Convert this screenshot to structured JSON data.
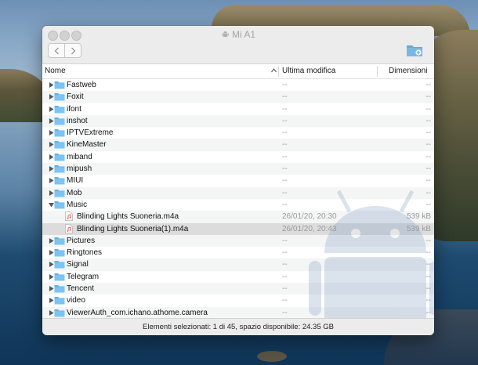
{
  "window": {
    "title": "Mi A1",
    "status": "Elementi selezionati: 1 di 45, spazio disponibile: 24.35 GB"
  },
  "columns": {
    "name": "Nome",
    "modified": "Ultima modifica",
    "size": "Dimensioni"
  },
  "rows": [
    {
      "name": "Fastweb",
      "modified": "--",
      "size": "--",
      "type": "folder",
      "expanded": false
    },
    {
      "name": "Foxit",
      "modified": "--",
      "size": "--",
      "type": "folder",
      "expanded": false
    },
    {
      "name": "ifont",
      "modified": "--",
      "size": "--",
      "type": "folder",
      "expanded": false
    },
    {
      "name": "inshot",
      "modified": "--",
      "size": "--",
      "type": "folder",
      "expanded": false
    },
    {
      "name": "IPTVExtreme",
      "modified": "--",
      "size": "--",
      "type": "folder",
      "expanded": false
    },
    {
      "name": "KineMaster",
      "modified": "--",
      "size": "--",
      "type": "folder",
      "expanded": false
    },
    {
      "name": "miband",
      "modified": "--",
      "size": "--",
      "type": "folder",
      "expanded": false
    },
    {
      "name": "mipush",
      "modified": "--",
      "size": "--",
      "type": "folder",
      "expanded": false
    },
    {
      "name": "MIUI",
      "modified": "--",
      "size": "--",
      "type": "folder",
      "expanded": false
    },
    {
      "name": "Mob",
      "modified": "--",
      "size": "--",
      "type": "folder",
      "expanded": false
    },
    {
      "name": "Music",
      "modified": "--",
      "size": "--",
      "type": "folder",
      "expanded": true
    },
    {
      "name": "Blinding Lights Suoneria.m4a",
      "modified": "26/01/20, 20:30",
      "size": "539 kB",
      "type": "file"
    },
    {
      "name": "Blinding Lights Suoneria(1).m4a",
      "modified": "26/01/20, 20:43",
      "size": "539 kB",
      "type": "file",
      "selected": true
    },
    {
      "name": "Pictures",
      "modified": "--",
      "size": "--",
      "type": "folder",
      "expanded": false
    },
    {
      "name": "Ringtones",
      "modified": "--",
      "size": "--",
      "type": "folder",
      "expanded": false
    },
    {
      "name": "Signal",
      "modified": "--",
      "size": "--",
      "type": "folder",
      "expanded": false
    },
    {
      "name": "Telegram",
      "modified": "--",
      "size": "--",
      "type": "folder",
      "expanded": false
    },
    {
      "name": "Tencent",
      "modified": "--",
      "size": "--",
      "type": "folder",
      "expanded": false
    },
    {
      "name": "video",
      "modified": "--",
      "size": "--",
      "type": "folder",
      "expanded": false
    },
    {
      "name": "ViewerAuth_com.ichano.athome.camera",
      "modified": "--",
      "size": "--",
      "type": "folder",
      "expanded": false
    }
  ],
  "colors": {
    "folder": "#5fb3ea",
    "selected_row": "#dcdcdc",
    "muted_text": "#9b9b9b"
  },
  "icons": {
    "back": "chevron-left-icon",
    "forward": "chevron-right-icon",
    "new_folder": "new-folder-icon",
    "folder": "folder-icon",
    "file": "audio-file-icon",
    "device": "android-device-icon"
  }
}
